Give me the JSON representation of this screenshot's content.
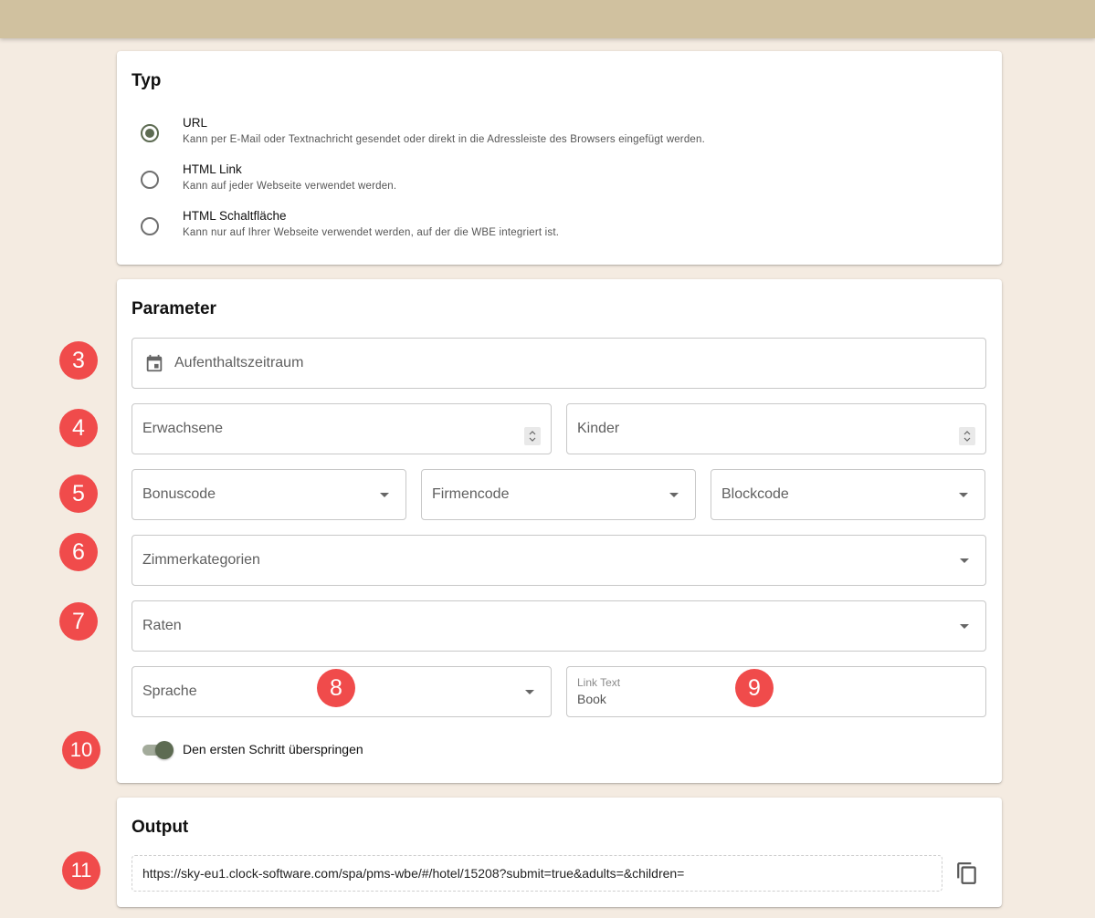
{
  "typ": {
    "title": "Typ",
    "options": [
      {
        "label": "URL",
        "description": "Kann per E-Mail oder Textnachricht gesendet oder direkt in die Adressleiste des Browsers eingefügt werden.",
        "selected": true
      },
      {
        "label": "HTML Link",
        "description": "Kann auf jeder Webseite verwendet werden.",
        "selected": false
      },
      {
        "label": "HTML Schaltfläche",
        "description": "Kann nur auf Ihrer Webseite verwendet werden, auf der die WBE integriert ist.",
        "selected": false
      }
    ]
  },
  "parameter": {
    "title": "Parameter",
    "stay_period": "Aufenthaltszeitraum",
    "adults": "Erwachsene",
    "children": "Kinder",
    "bonus_code": "Bonuscode",
    "company_code": "Firmencode",
    "block_code": "Blockcode",
    "room_categories": "Zimmerkategorien",
    "rates": "Raten",
    "language": "Sprache",
    "link_text_label": "Link Text",
    "link_text_value": "Book",
    "skip_first_step": "Den ersten Schritt überspringen",
    "skip_first_step_on": true
  },
  "output": {
    "title": "Output",
    "url": "https://sky-eu1.clock-software.com/spa/pms-wbe/#/hotel/15208?submit=true&adults=&children="
  },
  "badges": [
    "3",
    "4",
    "5",
    "6",
    "7",
    "8",
    "9",
    "10",
    "11"
  ],
  "colors": {
    "header": "#d0c19f",
    "background": "#f4ebe1",
    "accent": "#5d6b52",
    "badge": "#f04b4b"
  }
}
